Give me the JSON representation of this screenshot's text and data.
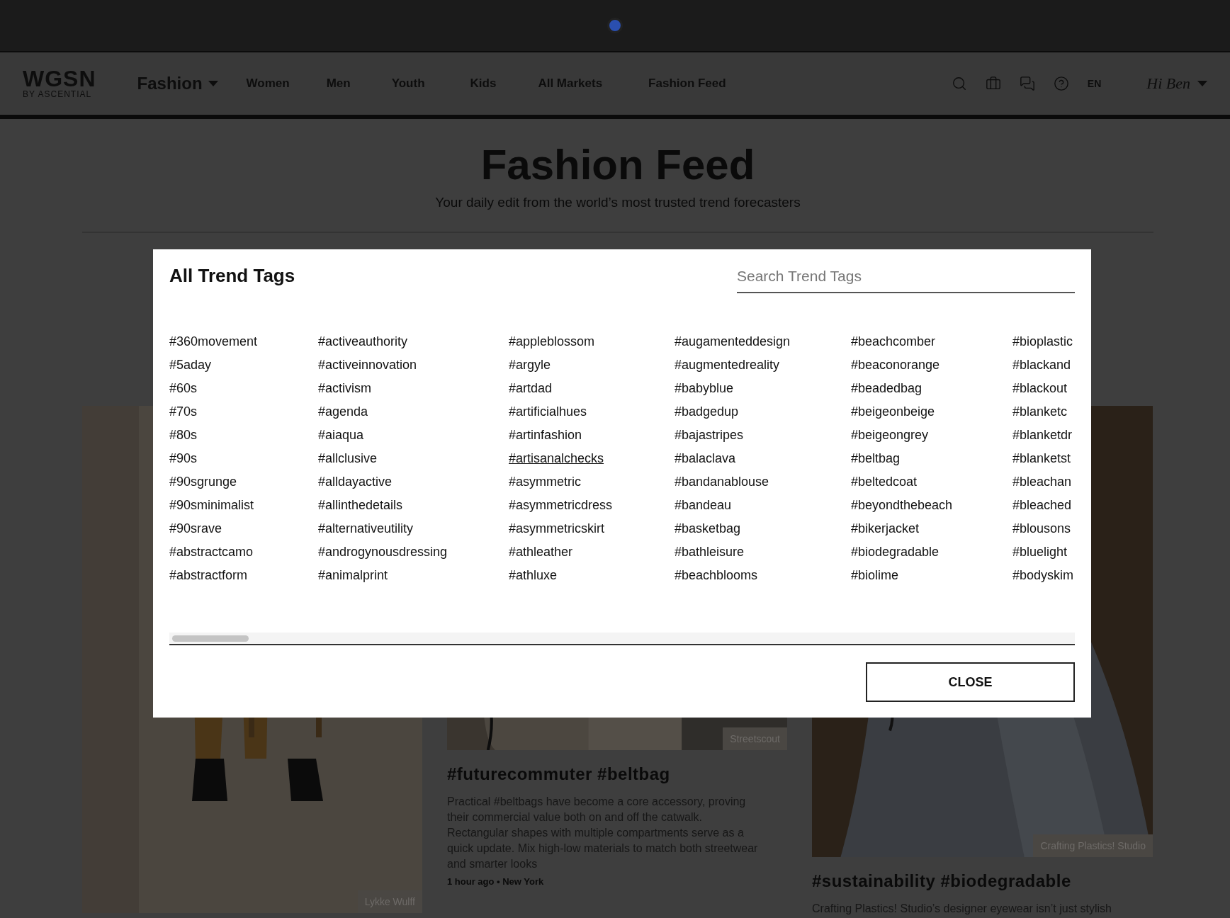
{
  "header": {
    "logo": "WGSN",
    "logo_sub": "BY ASCENTIAL",
    "section": "Fashion",
    "nav": [
      "Women",
      "Men",
      "Youth",
      "Kids",
      "All Markets",
      "Fashion Feed"
    ],
    "language": {
      "label": "EN",
      "selected": true
    },
    "greeting": "Hi Ben"
  },
  "page": {
    "title": "Fashion Feed",
    "subtitle": "Your daily edit from the world’s most trusted trend forecasters"
  },
  "cards": [
    {
      "caption": "Lykke Wulff"
    },
    {
      "caption": "Streetscout",
      "title": "#futurecommuter #beltbag",
      "body": "Practical #beltbags have become a core accessory, proving their commercial value both on and off the catwalk. Rectangular shapes with multiple compartments serve as a quick update. Mix high-low materials to match both streetwear and smarter looks",
      "meta": "1 hour ago • New York"
    },
    {
      "caption": "Crafting Plastics! Studio",
      "title": "#sustainability #biodegradable",
      "body": "Crafting Plastics! Studio’s designer eyewear isn’t just stylish"
    }
  ],
  "modal": {
    "title": "All Trend Tags",
    "search": {
      "placeholder": "Search Trend Tags"
    },
    "columns": [
      [
        {
          "label": "#360movement",
          "hovered": false
        },
        {
          "label": "#5aday",
          "hovered": false
        },
        {
          "label": "#60s",
          "hovered": false
        },
        {
          "label": "#70s",
          "hovered": false
        },
        {
          "label": "#80s",
          "hovered": false
        },
        {
          "label": "#90s",
          "hovered": false
        },
        {
          "label": "#90sgrunge",
          "hovered": false
        },
        {
          "label": "#90sminimalist",
          "hovered": false
        },
        {
          "label": "#90srave",
          "hovered": false
        },
        {
          "label": "#abstractcamo",
          "hovered": false
        },
        {
          "label": "#abstractform",
          "hovered": false
        }
      ],
      [
        {
          "label": "#activeauthority",
          "hovered": false
        },
        {
          "label": "#activeinnovation",
          "hovered": false
        },
        {
          "label": "#activism",
          "hovered": false
        },
        {
          "label": "#agenda",
          "hovered": false
        },
        {
          "label": "#aiaqua",
          "hovered": false
        },
        {
          "label": "#allclusive",
          "hovered": false
        },
        {
          "label": "#alldayactive",
          "hovered": false
        },
        {
          "label": "#allinthedetails",
          "hovered": false
        },
        {
          "label": "#alternativeutility",
          "hovered": false
        },
        {
          "label": "#androgynousdressing",
          "hovered": false
        },
        {
          "label": "#animalprint",
          "hovered": false
        }
      ],
      [
        {
          "label": "#appleblossom",
          "hovered": false
        },
        {
          "label": "#argyle",
          "hovered": false
        },
        {
          "label": "#artdad",
          "hovered": false
        },
        {
          "label": "#artificialhues",
          "hovered": false
        },
        {
          "label": "#artinfashion",
          "hovered": false
        },
        {
          "label": "#artisanalchecks",
          "hovered": true
        },
        {
          "label": "#asymmetric",
          "hovered": false
        },
        {
          "label": "#asymmetricdress",
          "hovered": false
        },
        {
          "label": "#asymmetricskirt",
          "hovered": false
        },
        {
          "label": "#athleather",
          "hovered": false
        },
        {
          "label": "#athluxe",
          "hovered": false
        }
      ],
      [
        {
          "label": "#augamenteddesign",
          "hovered": false
        },
        {
          "label": "#augmentedreality",
          "hovered": false
        },
        {
          "label": "#babyblue",
          "hovered": false
        },
        {
          "label": "#badgedup",
          "hovered": false
        },
        {
          "label": "#bajastripes",
          "hovered": false
        },
        {
          "label": "#balaclava",
          "hovered": false
        },
        {
          "label": "#bandanablouse",
          "hovered": false
        },
        {
          "label": "#bandeau",
          "hovered": false
        },
        {
          "label": "#basketbag",
          "hovered": false
        },
        {
          "label": "#bathleisure",
          "hovered": false
        },
        {
          "label": "#beachblooms",
          "hovered": false
        }
      ],
      [
        {
          "label": "#beachcomber",
          "hovered": false
        },
        {
          "label": "#beaconorange",
          "hovered": false
        },
        {
          "label": "#beadedbag",
          "hovered": false
        },
        {
          "label": "#beigeonbeige",
          "hovered": false
        },
        {
          "label": "#beigeongrey",
          "hovered": false
        },
        {
          "label": "#beltbag",
          "hovered": false
        },
        {
          "label": "#beltedcoat",
          "hovered": false
        },
        {
          "label": "#beyondthebeach",
          "hovered": false
        },
        {
          "label": "#bikerjacket",
          "hovered": false
        },
        {
          "label": "#biodegradable",
          "hovered": false
        },
        {
          "label": "#biolime",
          "hovered": false
        }
      ],
      [
        {
          "label": "#bioplastic",
          "hovered": false
        },
        {
          "label": "#blackand",
          "hovered": false
        },
        {
          "label": "#blackout",
          "hovered": false
        },
        {
          "label": "#blanketc",
          "hovered": false
        },
        {
          "label": "#blanketdr",
          "hovered": false
        },
        {
          "label": "#blanketst",
          "hovered": false
        },
        {
          "label": "#bleachan",
          "hovered": false
        },
        {
          "label": "#bleached",
          "hovered": false
        },
        {
          "label": "#blousons",
          "hovered": false
        },
        {
          "label": "#bluelight",
          "hovered": false
        },
        {
          "label": "#bodyskim",
          "hovered": false
        }
      ]
    ],
    "close": "CLOSE"
  }
}
